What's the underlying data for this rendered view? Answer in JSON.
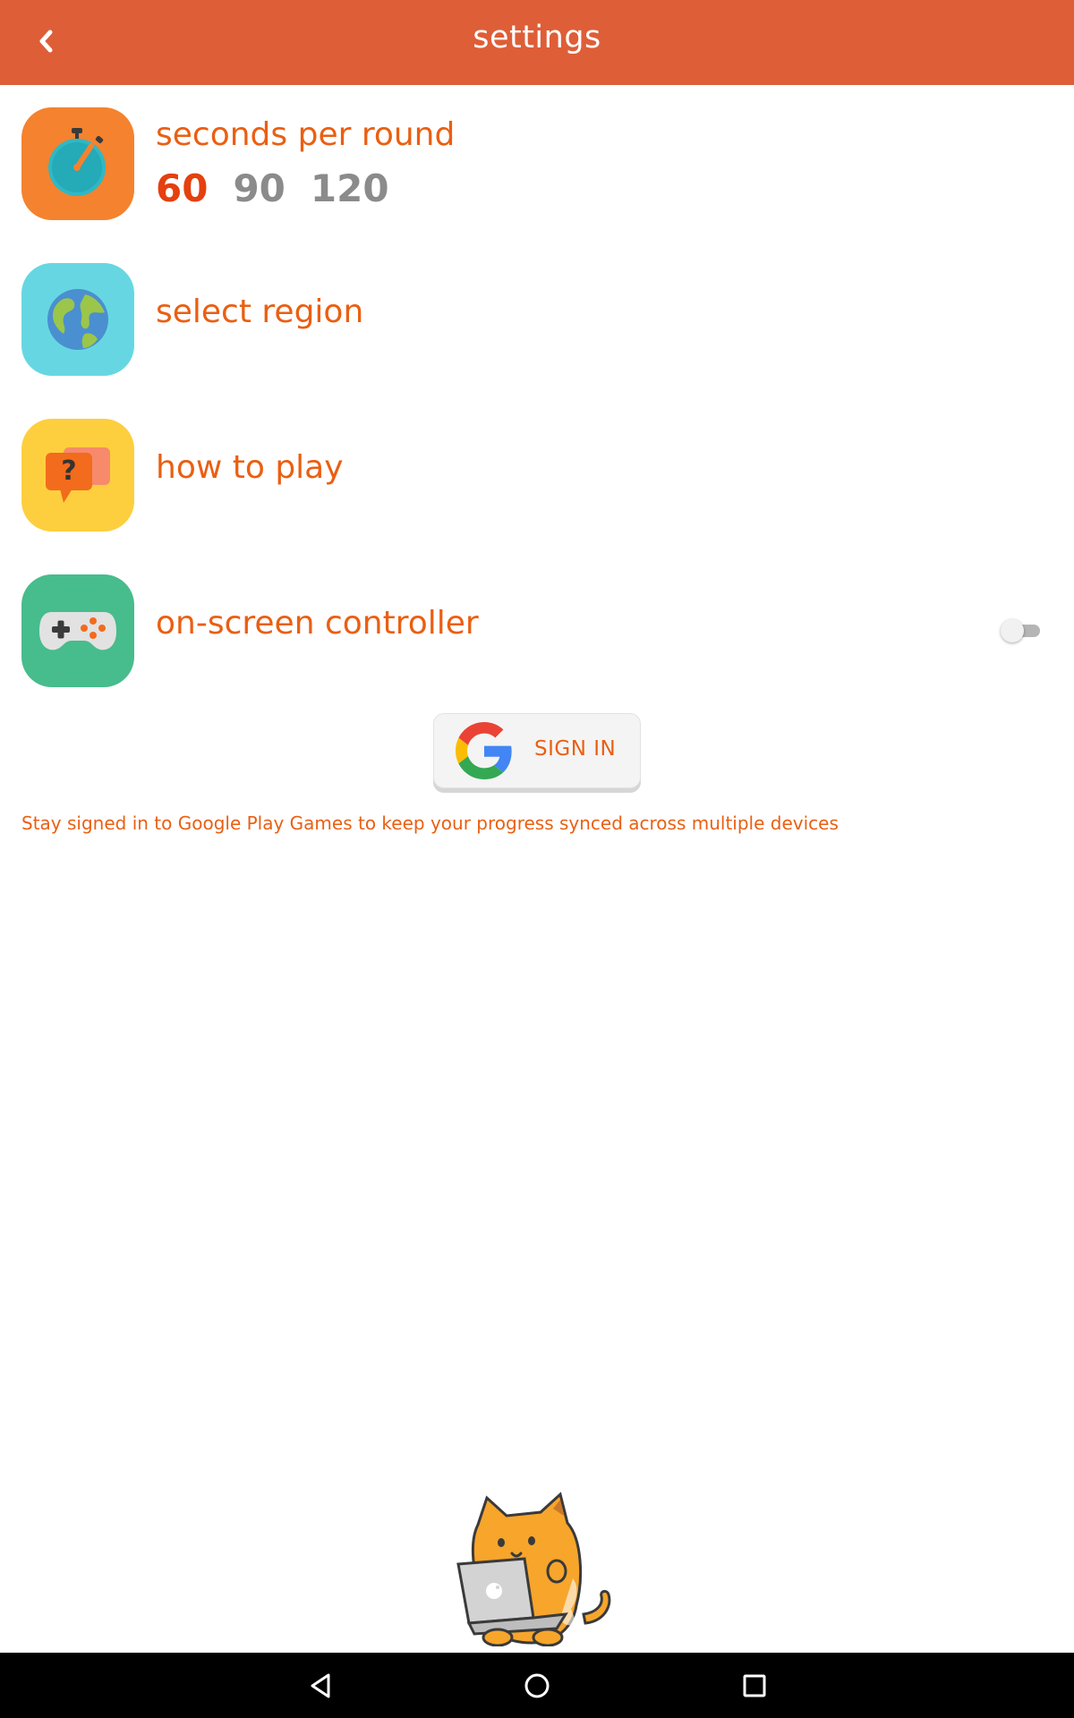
{
  "header": {
    "title": "settings",
    "background_color": "#de5e37",
    "back_icon": "chevron-left-icon"
  },
  "settings": {
    "seconds_per_round": {
      "label": "seconds per round",
      "icon": "stopwatch-icon",
      "tile_color": "#f5822e",
      "options": [
        "60",
        "90",
        "120"
      ],
      "selected": "60"
    },
    "select_region": {
      "label": "select region",
      "icon": "globe-icon",
      "tile_color": "#66d7e2"
    },
    "how_to_play": {
      "label": "how to play",
      "icon": "help-chat-icon",
      "tile_color": "#fdcf3e"
    },
    "on_screen_controller": {
      "label": "on-screen controller",
      "icon": "gamepad-icon",
      "tile_color": "#47bc8c",
      "enabled": false
    }
  },
  "signin": {
    "label": "SIGN IN",
    "icon": "google-icon",
    "note": "Stay signed in to Google Play Games to keep your progress synced across multiple devices"
  },
  "mascot": {
    "icon": "cat-laptop-illustration"
  },
  "nav_bar": {
    "back_icon": "nav-back-icon",
    "home_icon": "nav-home-icon",
    "recents_icon": "nav-recents-icon"
  },
  "colors": {
    "accent": "#ea5f12",
    "selected_option": "#e5400e",
    "unselected_option": "#8b8b8b"
  }
}
